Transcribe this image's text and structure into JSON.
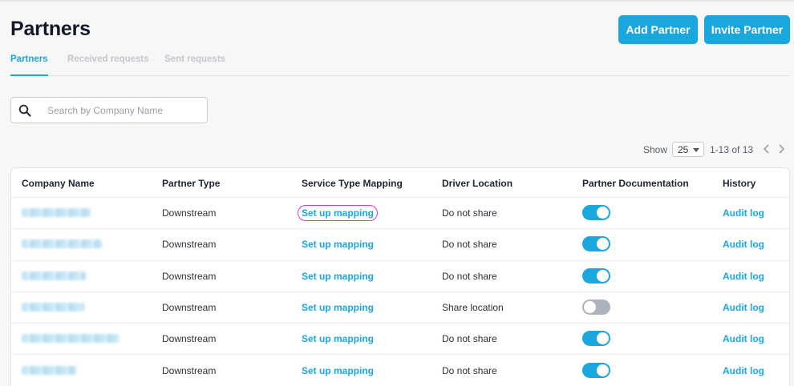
{
  "page": {
    "title": "Partners",
    "add_button": "Add Partner",
    "invite_button": "Invite Partner"
  },
  "tabs": [
    {
      "label": "Partners",
      "active": true
    },
    {
      "label": "Received requests",
      "active": false
    },
    {
      "label": "Sent requests",
      "active": false
    }
  ],
  "search": {
    "placeholder": "Search by Company Name",
    "value": ""
  },
  "pagination": {
    "show_label": "Show",
    "page_size": "25",
    "range": "1-13 of 13"
  },
  "table": {
    "headers": [
      "Company Name",
      "Partner Type",
      "Service Type Mapping",
      "Driver Location",
      "Partner Documentation",
      "History"
    ],
    "rows": [
      {
        "partner_type": "Downstream",
        "mapping": "Set up mapping",
        "driver_location": "Do not share",
        "documentation": true,
        "history": "Audit log"
      },
      {
        "partner_type": "Downstream",
        "mapping": "Set up mapping",
        "driver_location": "Do not share",
        "documentation": true,
        "history": "Audit log"
      },
      {
        "partner_type": "Downstream",
        "mapping": "Set up mapping",
        "driver_location": "Do not share",
        "documentation": true,
        "history": "Audit log"
      },
      {
        "partner_type": "Downstream",
        "mapping": "Set up mapping",
        "driver_location": "Share location",
        "documentation": false,
        "history": "Audit log"
      },
      {
        "partner_type": "Downstream",
        "mapping": "Set up mapping",
        "driver_location": "Do not share",
        "documentation": true,
        "history": "Audit log"
      },
      {
        "partner_type": "Downstream",
        "mapping": "Set up mapping",
        "driver_location": "Do not share",
        "documentation": true,
        "history": "Audit log"
      }
    ]
  },
  "colors": {
    "accent": "#1aa7dd",
    "highlight": "#d63ad3",
    "toggle_off": "#aeb2ba"
  },
  "icons": {
    "search": "search-icon",
    "prev": "chevron-left-icon",
    "next": "chevron-right-icon",
    "select": "caret-down-icon"
  }
}
